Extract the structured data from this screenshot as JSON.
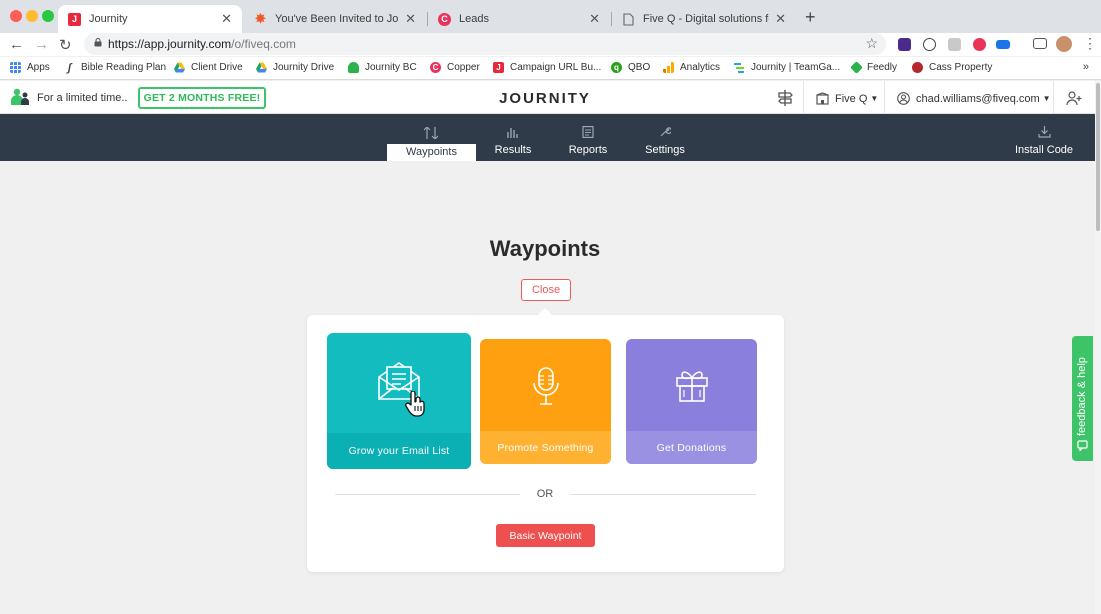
{
  "browser": {
    "tabs": [
      {
        "title": "Journity",
        "active": true,
        "favicon_color": "#e8283c",
        "favicon_glyph": "J"
      },
      {
        "title": "You've Been Invited to Journity",
        "active": false,
        "favicon_color": "#f05a28",
        "favicon_glyph": "✸"
      },
      {
        "title": "Leads",
        "active": false,
        "favicon_color": "#e8335a",
        "favicon_glyph": "C"
      },
      {
        "title": "Five Q - Digital solutions for m",
        "active": false,
        "favicon_color": "#9aa0a6",
        "favicon_glyph": "doc"
      }
    ],
    "new_tab": "+",
    "url_host": "https://app.journity.com",
    "url_path": "/o/fiveq.com"
  },
  "bookmarks": [
    {
      "label": "Apps",
      "icon": "apps-grid-icon",
      "color": "#4285f4"
    },
    {
      "label": "Bible Reading Plan",
      "icon": "bible-icon",
      "color": "#444444"
    },
    {
      "label": "Client Drive",
      "icon": "drive-icon",
      "color": "#1fa463"
    },
    {
      "label": "Journity Drive",
      "icon": "drive-icon",
      "color": "#1fa463"
    },
    {
      "label": "Journity BC",
      "icon": "basecamp-icon",
      "color": "#2bb24c"
    },
    {
      "label": "Copper",
      "icon": "copper-icon",
      "color": "#e8335a"
    },
    {
      "label": "Campaign URL Bu...",
      "icon": "journity-icon",
      "color": "#e8283c"
    },
    {
      "label": "QBO",
      "icon": "qbo-icon",
      "color": "#2ca01c"
    },
    {
      "label": "Analytics",
      "icon": "analytics-icon",
      "color": "#f9ab00"
    },
    {
      "label": "Journity | TeamGa...",
      "icon": "teamgantt-icon",
      "color": "#23a6d5"
    },
    {
      "label": "Feedly",
      "icon": "feedly-icon",
      "color": "#2bb24c"
    },
    {
      "label": "Cass Property",
      "icon": "cass-icon",
      "color": "#b5272d"
    }
  ],
  "bookmarks_more": "»",
  "header": {
    "promo_text": "For a limited time..",
    "promo_button": "GET 2 MONTHS FREE!",
    "logo": "JOURNITY",
    "org": "Five Q",
    "user_email": "chad.williams@fiveq.com"
  },
  "nav": {
    "tabs": [
      {
        "label": "Waypoints",
        "active": true
      },
      {
        "label": "Results",
        "active": false
      },
      {
        "label": "Reports",
        "active": false
      },
      {
        "label": "Settings",
        "active": false
      }
    ],
    "install": "Install Code"
  },
  "main": {
    "title": "Waypoints",
    "close": "Close",
    "cards": [
      {
        "label": "Grow your Email List",
        "color": "#12bcbf",
        "band": "#0ab0b3",
        "icon": "envelope-icon"
      },
      {
        "label": "Promote Something",
        "color": "#ffa010",
        "band": "#ffb131",
        "icon": "microphone-icon"
      },
      {
        "label": "Get Donations",
        "color": "#8a7fdc",
        "band": "#9a91e2",
        "icon": "gift-icon"
      }
    ],
    "or": "OR",
    "basic_button": "Basic Waypoint"
  },
  "feedback": "feedback & help",
  "colors": {
    "nav_dark": "#2f3b48",
    "accent_green": "#3ec468",
    "accent_red": "#ee4f4f"
  }
}
